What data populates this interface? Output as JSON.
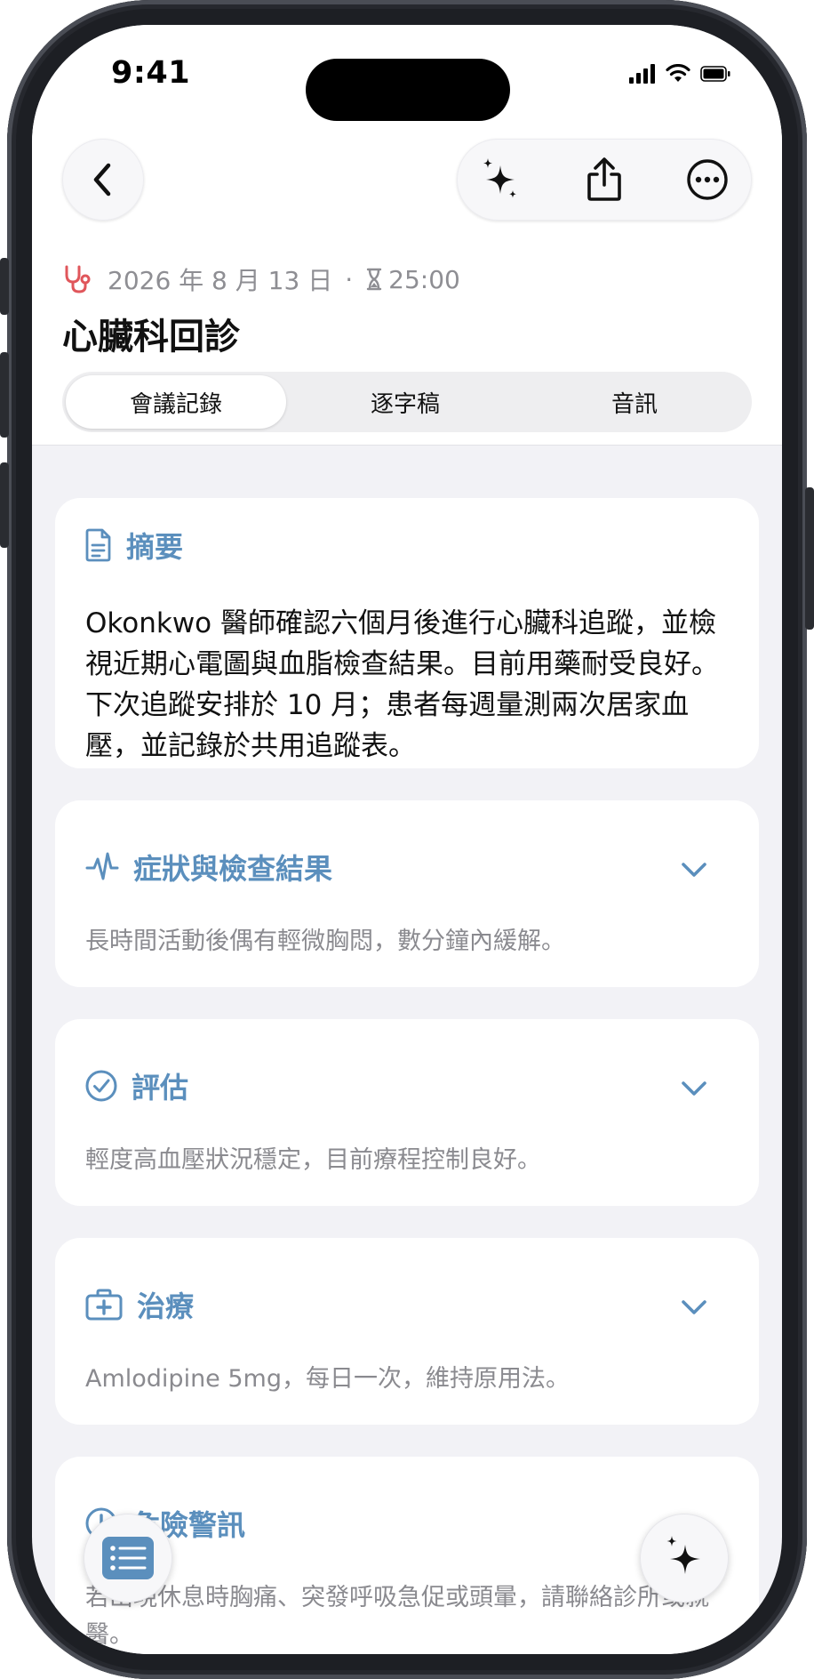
{
  "status_bar": {
    "time": "9:41"
  },
  "meta": {
    "date": "2026 年 8 月 13 日",
    "separator": "·",
    "duration": "25:00"
  },
  "page_title": "心臟科回診",
  "tabs": [
    {
      "label": "會議記錄",
      "active": true
    },
    {
      "label": "逐字稿",
      "active": false
    },
    {
      "label": "音訊",
      "active": false
    }
  ],
  "summary": {
    "title": "摘要",
    "body": "Okonkwo 醫師確認六個月後進行心臟科追蹤，並檢視近期心電圖與血脂檢查結果。目前用藥耐受良好。下次追蹤安排於 10 月；患者每週量測兩次居家血壓，並記錄於共用追蹤表。"
  },
  "sections": [
    {
      "title": "症狀與檢查結果",
      "body": "長時間活動後偶有輕微胸悶，數分鐘內緩解。",
      "icon": "waveform-icon"
    },
    {
      "title": "評估",
      "body": "輕度高血壓狀況穩定，目前療程控制良好。",
      "icon": "checkmark-circle-icon"
    },
    {
      "title": "治療",
      "body": "Amlodipine 5mg，每日一次，維持原用法。",
      "icon": "medical-kit-icon"
    },
    {
      "title": "危險警訊",
      "body": "若出現休息時胸痛、突發呼吸急促或頭暈，請聯絡診所或就醫。",
      "icon": "alert-icon"
    }
  ],
  "colors": {
    "accent": "#5b8fbd",
    "heart_icon": "#e0565b",
    "background": "#f2f2f6"
  }
}
